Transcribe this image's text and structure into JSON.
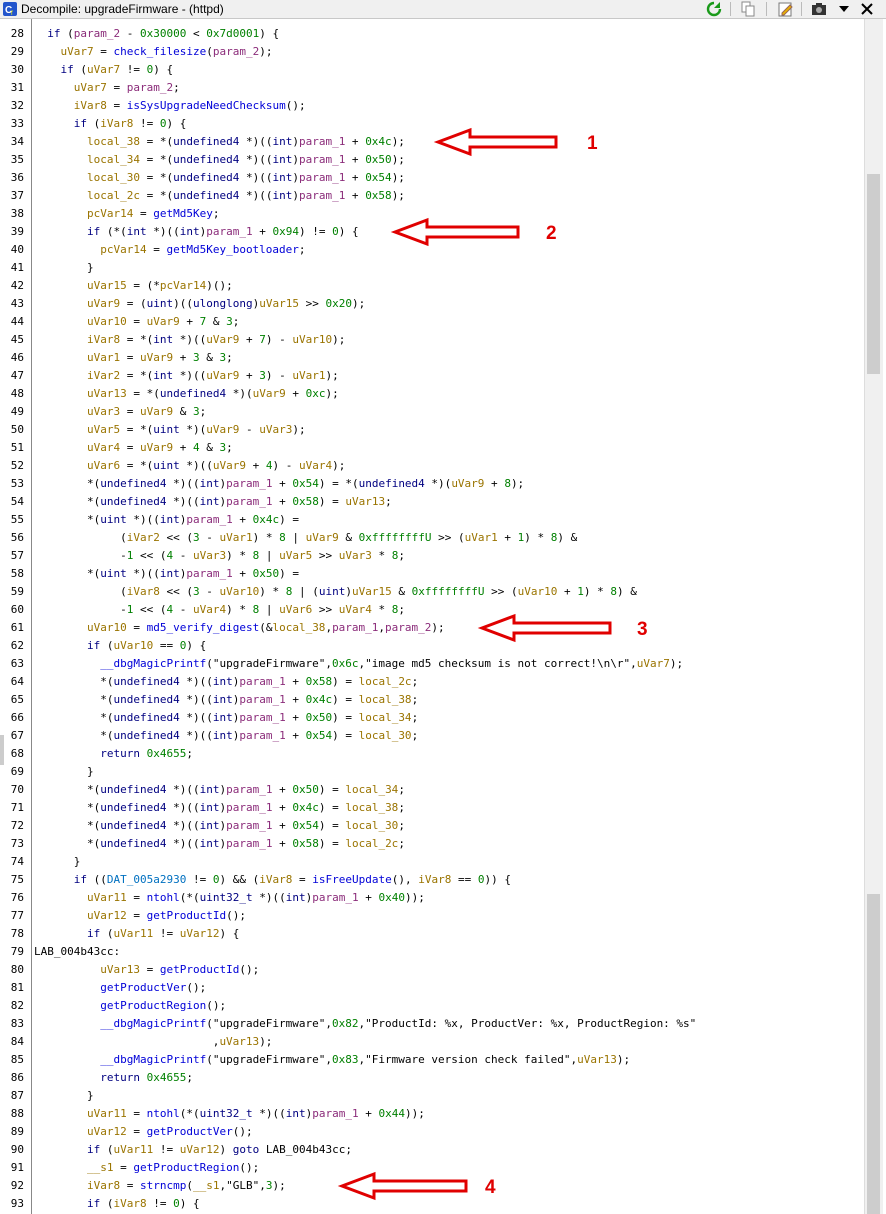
{
  "window": {
    "title": "Decompile: upgradeFirmware - (httpd)",
    "app_icon": "ghidra-decompiler-icon",
    "toolbar_icons": [
      "refresh-icon",
      "copy-icon",
      "edit-snapshot-icon",
      "camera-icon",
      "dropdown-menu-icon",
      "close-icon"
    ]
  },
  "code_lines": [
    {
      "n": "28",
      "t": "  if (param_2 - 0x30000 < 0x7d0001) {"
    },
    {
      "n": "29",
      "t": "    uVar7 = check_filesize(param_2);"
    },
    {
      "n": "30",
      "t": "    if (uVar7 != 0) {"
    },
    {
      "n": "31",
      "t": "      uVar7 = param_2;"
    },
    {
      "n": "32",
      "t": "      iVar8 = isSysUpgradeNeedChecksum();"
    },
    {
      "n": "33",
      "t": "      if (iVar8 != 0) {"
    },
    {
      "n": "34",
      "t": "        local_38 = *(undefined4 *)((int)param_1 + 0x4c);"
    },
    {
      "n": "35",
      "t": "        local_34 = *(undefined4 *)((int)param_1 + 0x50);"
    },
    {
      "n": "36",
      "t": "        local_30 = *(undefined4 *)((int)param_1 + 0x54);"
    },
    {
      "n": "37",
      "t": "        local_2c = *(undefined4 *)((int)param_1 + 0x58);"
    },
    {
      "n": "38",
      "t": "        pcVar14 = getMd5Key;"
    },
    {
      "n": "39",
      "t": "        if (*(int *)((int)param_1 + 0x94) != 0) {"
    },
    {
      "n": "40",
      "t": "          pcVar14 = getMd5Key_bootloader;"
    },
    {
      "n": "41",
      "t": "        }"
    },
    {
      "n": "42",
      "t": "        uVar15 = (*pcVar14)();"
    },
    {
      "n": "43",
      "t": "        uVar9 = (uint)((ulonglong)uVar15 >> 0x20);"
    },
    {
      "n": "44",
      "t": "        uVar10 = uVar9 + 7 & 3;"
    },
    {
      "n": "45",
      "t": "        iVar8 = *(int *)((uVar9 + 7) - uVar10);"
    },
    {
      "n": "46",
      "t": "        uVar1 = uVar9 + 3 & 3;"
    },
    {
      "n": "47",
      "t": "        iVar2 = *(int *)((uVar9 + 3) - uVar1);"
    },
    {
      "n": "48",
      "t": "        uVar13 = *(undefined4 *)(uVar9 + 0xc);"
    },
    {
      "n": "49",
      "t": "        uVar3 = uVar9 & 3;"
    },
    {
      "n": "50",
      "t": "        uVar5 = *(uint *)(uVar9 - uVar3);"
    },
    {
      "n": "51",
      "t": "        uVar4 = uVar9 + 4 & 3;"
    },
    {
      "n": "52",
      "t": "        uVar6 = *(uint *)((uVar9 + 4) - uVar4);"
    },
    {
      "n": "53",
      "t": "        *(undefined4 *)((int)param_1 + 0x54) = *(undefined4 *)(uVar9 + 8);"
    },
    {
      "n": "54",
      "t": "        *(undefined4 *)((int)param_1 + 0x58) = uVar13;"
    },
    {
      "n": "55",
      "t": "        *(uint *)((int)param_1 + 0x4c) ="
    },
    {
      "n": "56",
      "t": "             (iVar2 << (3 - uVar1) * 8 | uVar9 & 0xffffffffU >> (uVar1 + 1) * 8) &"
    },
    {
      "n": "57",
      "t": "             -1 << (4 - uVar3) * 8 | uVar5 >> uVar3 * 8;"
    },
    {
      "n": "58",
      "t": "        *(uint *)((int)param_1 + 0x50) ="
    },
    {
      "n": "59",
      "t": "             (iVar8 << (3 - uVar10) * 8 | (uint)uVar15 & 0xffffffffU >> (uVar10 + 1) * 8) &"
    },
    {
      "n": "60",
      "t": "             -1 << (4 - uVar4) * 8 | uVar6 >> uVar4 * 8;"
    },
    {
      "n": "61",
      "t": "        uVar10 = md5_verify_digest(&local_38,param_1,param_2);"
    },
    {
      "n": "62",
      "t": "        if (uVar10 == 0) {"
    },
    {
      "n": "63",
      "t": "          __dbgMagicPrintf(\"upgradeFirmware\",0x6c,\"image md5 checksum is not correct!\\n\\r\",uVar7);"
    },
    {
      "n": "64",
      "t": "          *(undefined4 *)((int)param_1 + 0x58) = local_2c;"
    },
    {
      "n": "65",
      "t": "          *(undefined4 *)((int)param_1 + 0x4c) = local_38;"
    },
    {
      "n": "66",
      "t": "          *(undefined4 *)((int)param_1 + 0x50) = local_34;"
    },
    {
      "n": "67",
      "t": "          *(undefined4 *)((int)param_1 + 0x54) = local_30;"
    },
    {
      "n": "68",
      "t": "          return 0x4655;"
    },
    {
      "n": "69",
      "t": "        }"
    },
    {
      "n": "70",
      "t": "        *(undefined4 *)((int)param_1 + 0x50) = local_34;"
    },
    {
      "n": "71",
      "t": "        *(undefined4 *)((int)param_1 + 0x4c) = local_38;"
    },
    {
      "n": "72",
      "t": "        *(undefined4 *)((int)param_1 + 0x54) = local_30;"
    },
    {
      "n": "73",
      "t": "        *(undefined4 *)((int)param_1 + 0x58) = local_2c;"
    },
    {
      "n": "74",
      "t": "      }"
    },
    {
      "n": "75",
      "t": "      if ((DAT_005a2930 != 0) && (iVar8 = isFreeUpdate(), iVar8 == 0)) {"
    },
    {
      "n": "76",
      "t": "        uVar11 = ntohl(*(uint32_t *)((int)param_1 + 0x40));"
    },
    {
      "n": "77",
      "t": "        uVar12 = getProductId();"
    },
    {
      "n": "78",
      "t": "        if (uVar11 != uVar12) {"
    },
    {
      "n": "79",
      "t": "LAB_004b43cc:"
    },
    {
      "n": "80",
      "t": "          uVar13 = getProductId();"
    },
    {
      "n": "81",
      "t": "          getProductVer();"
    },
    {
      "n": "82",
      "t": "          getProductRegion();"
    },
    {
      "n": "83",
      "t": "          __dbgMagicPrintf(\"upgradeFirmware\",0x82,\"ProductId: %x, ProductVer: %x, ProductRegion: %s\""
    },
    {
      "n": "84",
      "t": "                           ,uVar13);"
    },
    {
      "n": "85",
      "t": "          __dbgMagicPrintf(\"upgradeFirmware\",0x83,\"Firmware version check failed\",uVar13);"
    },
    {
      "n": "86",
      "t": "          return 0x4655;"
    },
    {
      "n": "87",
      "t": "        }"
    },
    {
      "n": "88",
      "t": "        uVar11 = ntohl(*(uint32_t *)((int)param_1 + 0x44));"
    },
    {
      "n": "89",
      "t": "        uVar12 = getProductVer();"
    },
    {
      "n": "90",
      "t": "        if (uVar11 != uVar12) goto LAB_004b43cc;"
    },
    {
      "n": "91",
      "t": "        __s1 = getProductRegion();"
    },
    {
      "n": "92",
      "t": "        iVar8 = strncmp(__s1,\"GLB\",3);"
    },
    {
      "n": "93",
      "t": "        if (iVar8 != 0) {"
    }
  ],
  "annotations": [
    {
      "label": "1",
      "line": "34"
    },
    {
      "label": "2",
      "line": "39"
    },
    {
      "label": "3",
      "line": "61"
    },
    {
      "label": "4",
      "line": "92"
    }
  ],
  "colors": {
    "annotation_red": "#e00000",
    "keyword": "#000080",
    "function": "#0000d8",
    "variable": "#9a7400",
    "parameter": "#8b2c7a",
    "constant": "#008000",
    "global": "#0070c0"
  }
}
